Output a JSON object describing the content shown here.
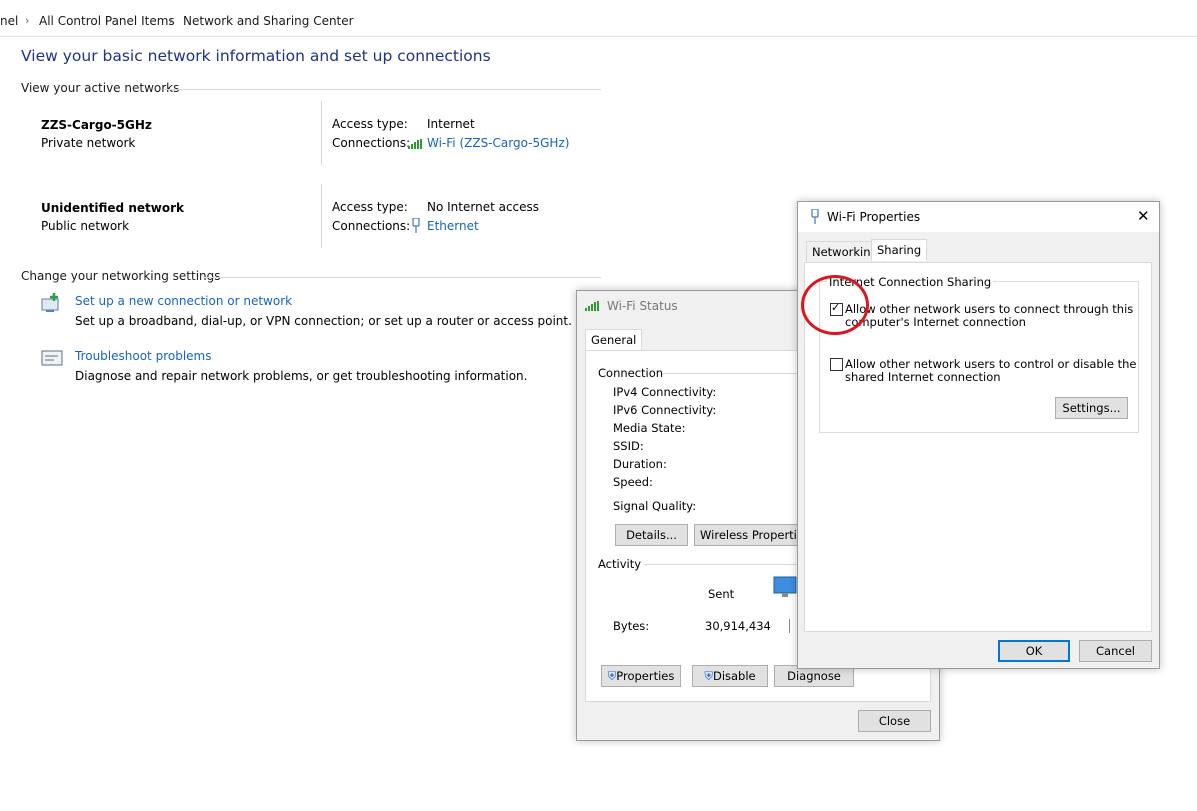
{
  "breadcrumb": {
    "items": [
      "nel",
      "All Control Panel Items",
      "Network and Sharing Center"
    ]
  },
  "page": {
    "title": "View your basic network information and set up connections",
    "active_networks_header": "View your active networks",
    "change_settings_header": "Change your networking settings"
  },
  "networks": [
    {
      "name": "ZZS-Cargo-5GHz",
      "category": "Private network",
      "access_type_label": "Access type:",
      "access_type": "Internet",
      "connections_label": "Connections:",
      "connection": "Wi-Fi (ZZS-Cargo-5GHz)"
    },
    {
      "name": "Unidentified network",
      "category": "Public network",
      "access_type_label": "Access type:",
      "access_type": "No Internet access",
      "connections_label": "Connections:",
      "connection": "Ethernet"
    }
  ],
  "settings": [
    {
      "link": "Set up a new connection or network",
      "desc": "Set up a broadband, dial-up, or VPN connection; or set up a router or access point.",
      "icon": "new-connection-icon"
    },
    {
      "link": "Troubleshoot problems",
      "desc": "Diagnose and repair network problems, or get troubleshooting information.",
      "icon": "troubleshoot-icon"
    }
  ],
  "wifi_status": {
    "title": "Wi-Fi Status",
    "tab": "General",
    "connection_group": "Connection",
    "fields": [
      "IPv4 Connectivity:",
      "IPv6 Connectivity:",
      "Media State:",
      "SSID:",
      "Duration:",
      "Speed:"
    ],
    "signal_quality": "Signal Quality:",
    "details_btn": "Details...",
    "wireless_btn": "Wireless Properties",
    "activity_group": "Activity",
    "sent_label": "Sent",
    "bytes_label": "Bytes:",
    "bytes_sent": "30,914,434",
    "properties_btn": "Properties",
    "disable_btn": "Disable",
    "diagnose_btn": "Diagnose",
    "close_btn": "Close"
  },
  "wifi_props": {
    "title": "Wi-Fi Properties",
    "tabs": [
      "Networking",
      "Sharing"
    ],
    "active_tab": "Sharing",
    "group": "Internet Connection Sharing",
    "allow_connect_line1": "Allow other network users to connect through this",
    "allow_connect_line2": "computer's Internet connection",
    "allow_connect_checked": true,
    "allow_control_line1": "Allow other network users to control or disable the",
    "allow_control_line2": "shared Internet connection",
    "allow_control_checked": false,
    "settings_btn": "Settings...",
    "ok_btn": "OK",
    "cancel_btn": "Cancel"
  },
  "colors": {
    "title_blue": "#1e3287",
    "link_blue": "#1565c0",
    "annotation_red": "#e0141e"
  }
}
